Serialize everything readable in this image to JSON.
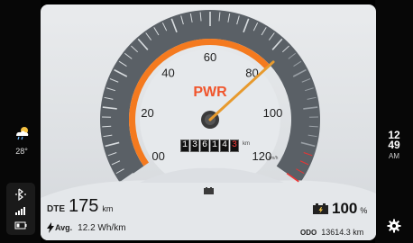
{
  "weather": {
    "icon": "cloud-rain-icon",
    "temperature": "28°"
  },
  "clock": {
    "hour": "12",
    "minute": "49",
    "ampm": "AM"
  },
  "gauge": {
    "mode_label": "PWR",
    "ticks": [
      "00",
      "20",
      "40",
      "60",
      "80",
      "100",
      "120"
    ],
    "unit": "km/h",
    "speed_value_fraction": 0.69,
    "odometer_digits": [
      "1",
      "3",
      "6",
      "1",
      "4",
      "3"
    ],
    "odometer_unit": "km"
  },
  "range": {
    "label": "DTE",
    "value": "175",
    "unit": "km"
  },
  "average": {
    "label": "Avg.",
    "value": "12.2 Wh/km"
  },
  "battery": {
    "value": "100",
    "unit": "%"
  },
  "odo": {
    "label": "ODO",
    "value": "13614.3 km"
  },
  "colors": {
    "accent": "#f47a1f",
    "needle": "#e79a2e",
    "pwr": "#f0552c"
  }
}
